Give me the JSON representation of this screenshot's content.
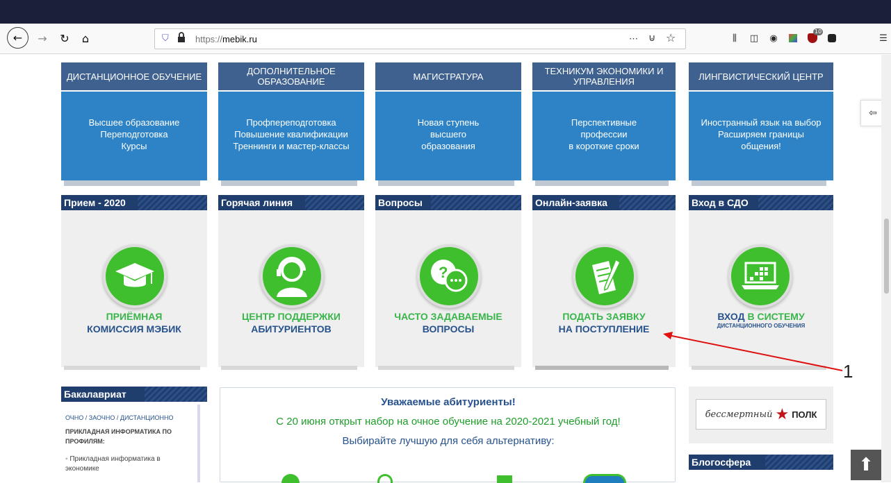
{
  "browser": {
    "url_prefix": "https://",
    "url_host": "mebik.ru",
    "reader_icon": "⋯",
    "pocket_icon": "☐",
    "star_icon": "☆",
    "ext_badge": "10"
  },
  "programs": [
    {
      "title": "ДИСТАНЦИОННОЕ ОБУЧЕНИЕ",
      "lines": [
        "Высшее образование",
        "Переподготовка",
        "Курсы"
      ]
    },
    {
      "title": "ДОПОЛНИТЕЛЬНОЕ ОБРАЗОВАНИЕ",
      "lines": [
        "Профпереподготовка",
        "Повышение квалификации",
        "Треннинги и мастер-классы"
      ]
    },
    {
      "title": "МАГИСТРАТУРА",
      "lines": [
        "Новая ступень",
        "высшего",
        "образования"
      ]
    },
    {
      "title": "ТЕХНИКУМ ЭКОНОМИКИ И УПРАВЛЕНИЯ",
      "lines": [
        "Перспективные",
        "профессии",
        "в короткие сроки"
      ]
    },
    {
      "title": "ЛИНГВИСТИЧЕСКИЙ ЦЕНТР",
      "lines": [
        "Иностранный язык на выбор",
        "Расширяем границы",
        "общения!"
      ]
    }
  ],
  "cards": [
    {
      "head": "Прием - 2020",
      "cap1": "ПРИЁМНАЯ",
      "cap2": "КОМИССИЯ МЭБИК"
    },
    {
      "head": "Горячая линия",
      "cap1": "ЦЕНТР ПОДДЕРЖКИ",
      "cap2": "АБИТУРИЕНТОВ"
    },
    {
      "head": "Вопросы",
      "cap1": "ЧАСТО ЗАДАВАЕМЫЕ",
      "cap2": "ВОПРОСЫ"
    },
    {
      "head": "Онлайн-заявка",
      "cap1": "ПОДАТЬ ЗАЯВКУ",
      "cap2": "НА ПОСТУПЛЕНИЕ"
    },
    {
      "head": "Вход в СДО",
      "cap1a": "ВХОД",
      "cap1b": "В СИСТЕМУ",
      "cap2": "ДИСТАНЦИОННОГО ОБУЧЕНИЯ"
    }
  ],
  "bachelor": {
    "head": "Бакалавриат",
    "modes": "ОЧНО / ЗАОЧНО / ДИСТАНЦИОННО",
    "profiles_label": "ПРИКЛАДНАЯ ИНФОРМАТИКА ПО ПРОФИЛЯМ:",
    "item1": "Прикладная информатика в экономике"
  },
  "notice": {
    "line1": "Уважаемые абитуриенты!",
    "line2": "С 20 июня открыт набор на очное обучение на 2020-2021 учебный год!",
    "line3": "Выбирайте лучшую для себя альтернативу:"
  },
  "right": {
    "polk_script": "бессмертный",
    "polk_word": "ПОЛК",
    "blog_head": "Блогосфера"
  },
  "annotation": "1",
  "up_arrow": "⬆"
}
